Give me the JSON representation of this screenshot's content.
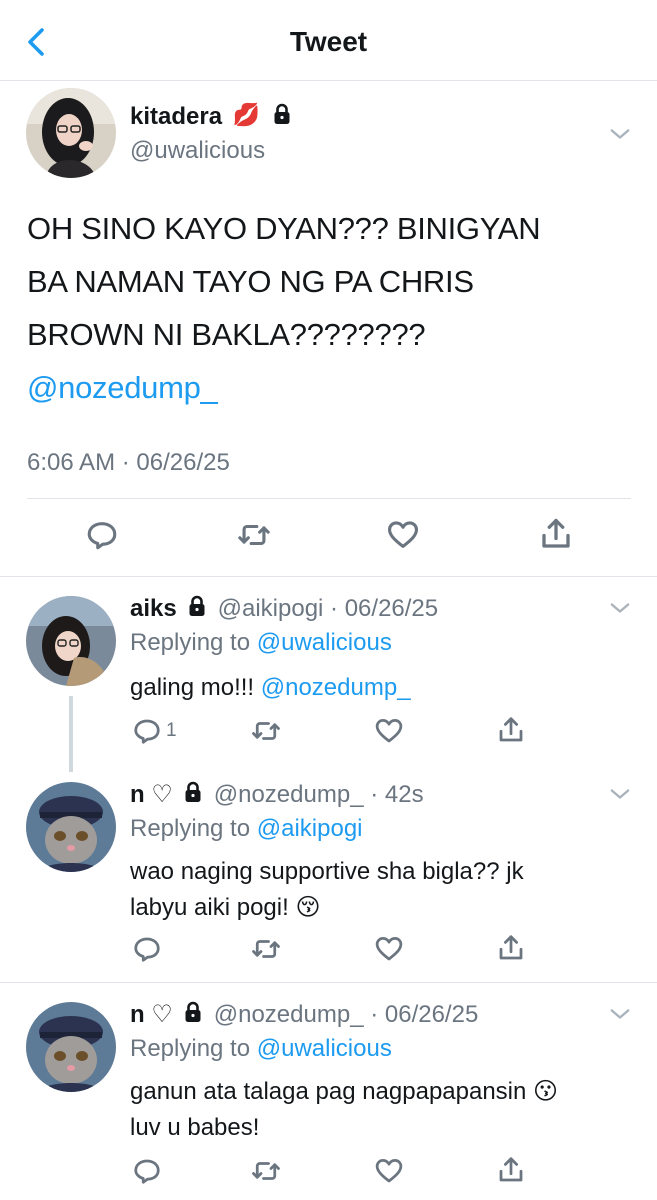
{
  "header": {
    "title": "Tweet",
    "back_icon": "chevron-left-icon"
  },
  "colors": {
    "link": "#1d9bf0",
    "muted": "#6b7580",
    "divider": "#e1e4e8"
  },
  "main_tweet": {
    "name": "kitadera",
    "name_emoji": "💋",
    "handle": "@uwalicious",
    "text_lines": [
      "OH SINO KAYO DYAN??? BINIGYAN",
      "BA NAMAN TAYO NG PA CHRIS",
      "BROWN NI BAKLA????????"
    ],
    "mention": "@nozedump_",
    "timestamp": "6:06 AM · 06/26/25"
  },
  "replies": [
    {
      "name": "aiks",
      "handle_time": "@aikipogi · 06/26/25",
      "replying_prefix": "Replying to",
      "replying_to": "@uwalicious",
      "text": "galing mo!!!",
      "mention": "@nozedump_",
      "reply_count": "1"
    },
    {
      "name": "n ♡",
      "handle_time": "@nozedump_ · 42s",
      "replying_prefix": "Replying to",
      "replying_to": "@aikipogi",
      "text_line1": "wao naging supportive sha bigla?? jk",
      "text_line2": "labyu aiki pogi!",
      "emoji": "😚"
    },
    {
      "name": "n ♡",
      "handle_time": "@nozedump_ · 06/26/25",
      "replying_prefix": "Replying to",
      "replying_to": "@uwalicious",
      "text_line1": "ganun ata talaga pag nagpapapansin",
      "text_line2": "luv u babes!",
      "emoji": "😗"
    }
  ],
  "icons": {
    "reply": "reply-icon",
    "retweet": "retweet-icon",
    "like": "heart-icon",
    "share": "share-icon",
    "lock": "lock-icon",
    "more": "chevron-down-icon"
  }
}
